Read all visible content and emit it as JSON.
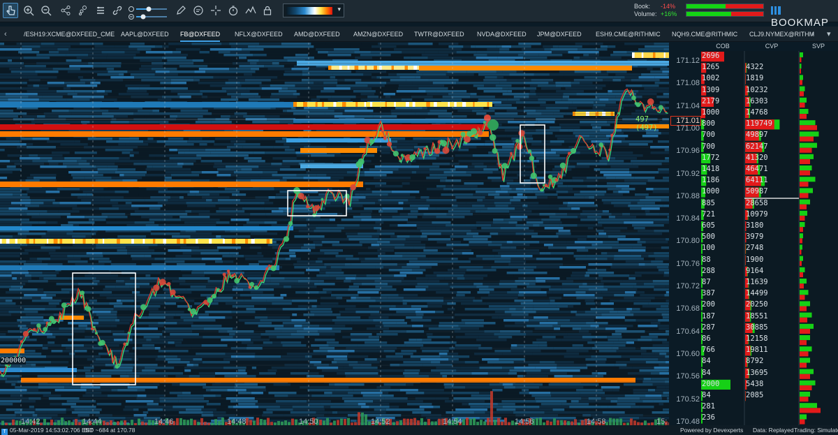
{
  "toolbar": {
    "icons": [
      "pointer-icon",
      "zoom-in-icon",
      "zoom-out-icon",
      "share-icon",
      "volume-dots-icon",
      "layers-icon",
      "link-icon",
      "slider-brightness-icon",
      "slider-contrast-icon",
      "pencil-icon",
      "chat-icon",
      "crosshair-icon",
      "stopwatch-icon",
      "chart-signal-icon",
      "lock-icon",
      "heatmap-palette-dropdown"
    ],
    "book_label": "Book:",
    "volume_label": "Volume:",
    "book_change": "-14%",
    "volume_change": "+16%",
    "brand": "BOOKMAP",
    "colors": {
      "negative": "#ff4d4d",
      "positive": "#33e433",
      "accent": "#3fa1e8"
    }
  },
  "tabs": [
    {
      "label": "/ESH19:XCME@DXFEED_CME",
      "active": false
    },
    {
      "label": "AAPL@DXFEED",
      "active": false
    },
    {
      "label": "FB@DXFEED",
      "active": true
    },
    {
      "label": "NFLX@DXFEED",
      "active": false
    },
    {
      "label": "AMD@DXFEED",
      "active": false
    },
    {
      "label": "AMZN@DXFEED",
      "active": false
    },
    {
      "label": "TWTR@DXFEED",
      "active": false
    },
    {
      "label": "NVDA@DXFEED",
      "active": false
    },
    {
      "label": "JPM@DXFEED",
      "active": false
    },
    {
      "label": "ESH9.CME@RITHMIC",
      "active": false
    },
    {
      "label": "NQH9.CME@RITHMIC",
      "active": false
    },
    {
      "label": "CLJ9.NYMEX@RITHM",
      "active": false
    }
  ],
  "chart": {
    "price_labels": [
      "171.12",
      "171.08",
      "171.04",
      "171.00",
      "170.96",
      "170.92",
      "170.88",
      "170.84",
      "170.80",
      "170.76",
      "170.72",
      "170.68",
      "170.64",
      "170.60",
      "170.56",
      "170.52",
      "170.48"
    ],
    "last_price": "171.01",
    "last_trade_label": "497 (497)",
    "level_label": "200000",
    "time_labels": [
      "14:42",
      "14:44",
      "14:46",
      "14:48",
      "14:50",
      "14:52",
      "14:54",
      "14:56",
      "14:58",
      "15:"
    ]
  },
  "panels": {
    "cob_header": "COB",
    "cvp_header": "CVP",
    "svp_header": "SVP",
    "cob": [
      "2696",
      "1265",
      "1002",
      "1309",
      "2179",
      "1000",
      "800",
      "700",
      "700",
      "1772",
      "1418",
      "1186",
      "1000",
      "885",
      "721",
      "605",
      "500",
      "100",
      "88",
      "288",
      "87",
      "387",
      "200",
      "187",
      "287",
      "86",
      "766",
      "84",
      "84",
      "2000",
      "84",
      "281",
      "236"
    ],
    "cob_side": [
      "ask",
      "ask",
      "ask",
      "ask",
      "ask",
      "ask",
      "bid",
      "bid",
      "bid",
      "bid",
      "bid",
      "bid",
      "bid",
      "bid",
      "bid",
      "bid",
      "bid",
      "bid",
      "bid",
      "bid",
      "bid",
      "bid",
      "bid",
      "bid",
      "bid",
      "bid",
      "bid",
      "bid",
      "bid",
      "bid",
      "bid",
      "bid",
      "bid"
    ],
    "cob_size": [
      0.55,
      0.12,
      0.08,
      0.12,
      0.3,
      0.1,
      0.07,
      0.06,
      0.06,
      0.22,
      0.14,
      0.12,
      0.1,
      0.08,
      0.06,
      0.05,
      0.04,
      0.02,
      0.02,
      0.03,
      0.02,
      0.04,
      0.02,
      0.02,
      0.03,
      0.02,
      0.07,
      0.02,
      0.02,
      0.7,
      0.02,
      0.03,
      0.02
    ],
    "cvp": [
      "",
      "4322",
      "1819",
      "10232",
      "16303",
      "14768",
      "119749",
      "49897",
      "62147",
      "41320",
      "46471",
      "64111",
      "50987",
      "28658",
      "10979",
      "3180",
      "3979",
      "2748",
      "1900",
      "9164",
      "11639",
      "14499",
      "20250",
      "18551",
      "30885",
      "12158",
      "19811",
      "8792",
      "13695",
      "5438",
      "2085",
      "",
      ""
    ],
    "cvp_buy": [
      0,
      0.03,
      0.01,
      0.06,
      0.1,
      0.09,
      0.65,
      0.3,
      0.36,
      0.25,
      0.28,
      0.37,
      0.3,
      0.17,
      0.06,
      0.02,
      0.02,
      0.015,
      0.01,
      0.05,
      0.07,
      0.08,
      0.12,
      0.11,
      0.18,
      0.07,
      0.12,
      0.05,
      0.08,
      0.03,
      0.01,
      0,
      0
    ],
    "cvp_sell": [
      0,
      0.02,
      0.01,
      0.05,
      0.08,
      0.07,
      0.55,
      0.26,
      0.32,
      0.22,
      0.24,
      0.3,
      0.26,
      0.14,
      0.05,
      0.02,
      0.02,
      0.01,
      0.01,
      0.04,
      0.06,
      0.07,
      0.1,
      0.09,
      0.14,
      0.06,
      0.1,
      0.04,
      0.07,
      0.03,
      0.01,
      0,
      0
    ],
    "svp_buy": [
      0.1,
      0.05,
      0.1,
      0.15,
      0.2,
      0.25,
      0.45,
      0.55,
      0.5,
      0.4,
      0.35,
      0.45,
      0.38,
      0.3,
      0.22,
      0.15,
      0.1,
      0.08,
      0.1,
      0.15,
      0.2,
      0.25,
      0.3,
      0.35,
      0.4,
      0.3,
      0.35,
      0.3,
      0.4,
      0.45,
      0.3,
      0.5,
      0.2
    ],
    "svp_sell": [
      0.05,
      0.04,
      0.08,
      0.12,
      0.15,
      0.2,
      0.5,
      0.4,
      0.35,
      0.3,
      0.3,
      0.25,
      0.25,
      0.2,
      0.15,
      0.1,
      0.08,
      0.05,
      0.06,
      0.1,
      0.12,
      0.15,
      0.2,
      0.22,
      0.3,
      0.2,
      0.25,
      0.2,
      0.3,
      0.35,
      0.25,
      0.6,
      0.15
    ]
  },
  "status": {
    "datetime": "05-Mar-2019 14:53:02.706 EST",
    "bid": "BID ~684 at 170.78",
    "powered": "Powered by Devexperts",
    "data_mode": "Data: Replayed",
    "trading_mode": "Trading: Simulated"
  }
}
